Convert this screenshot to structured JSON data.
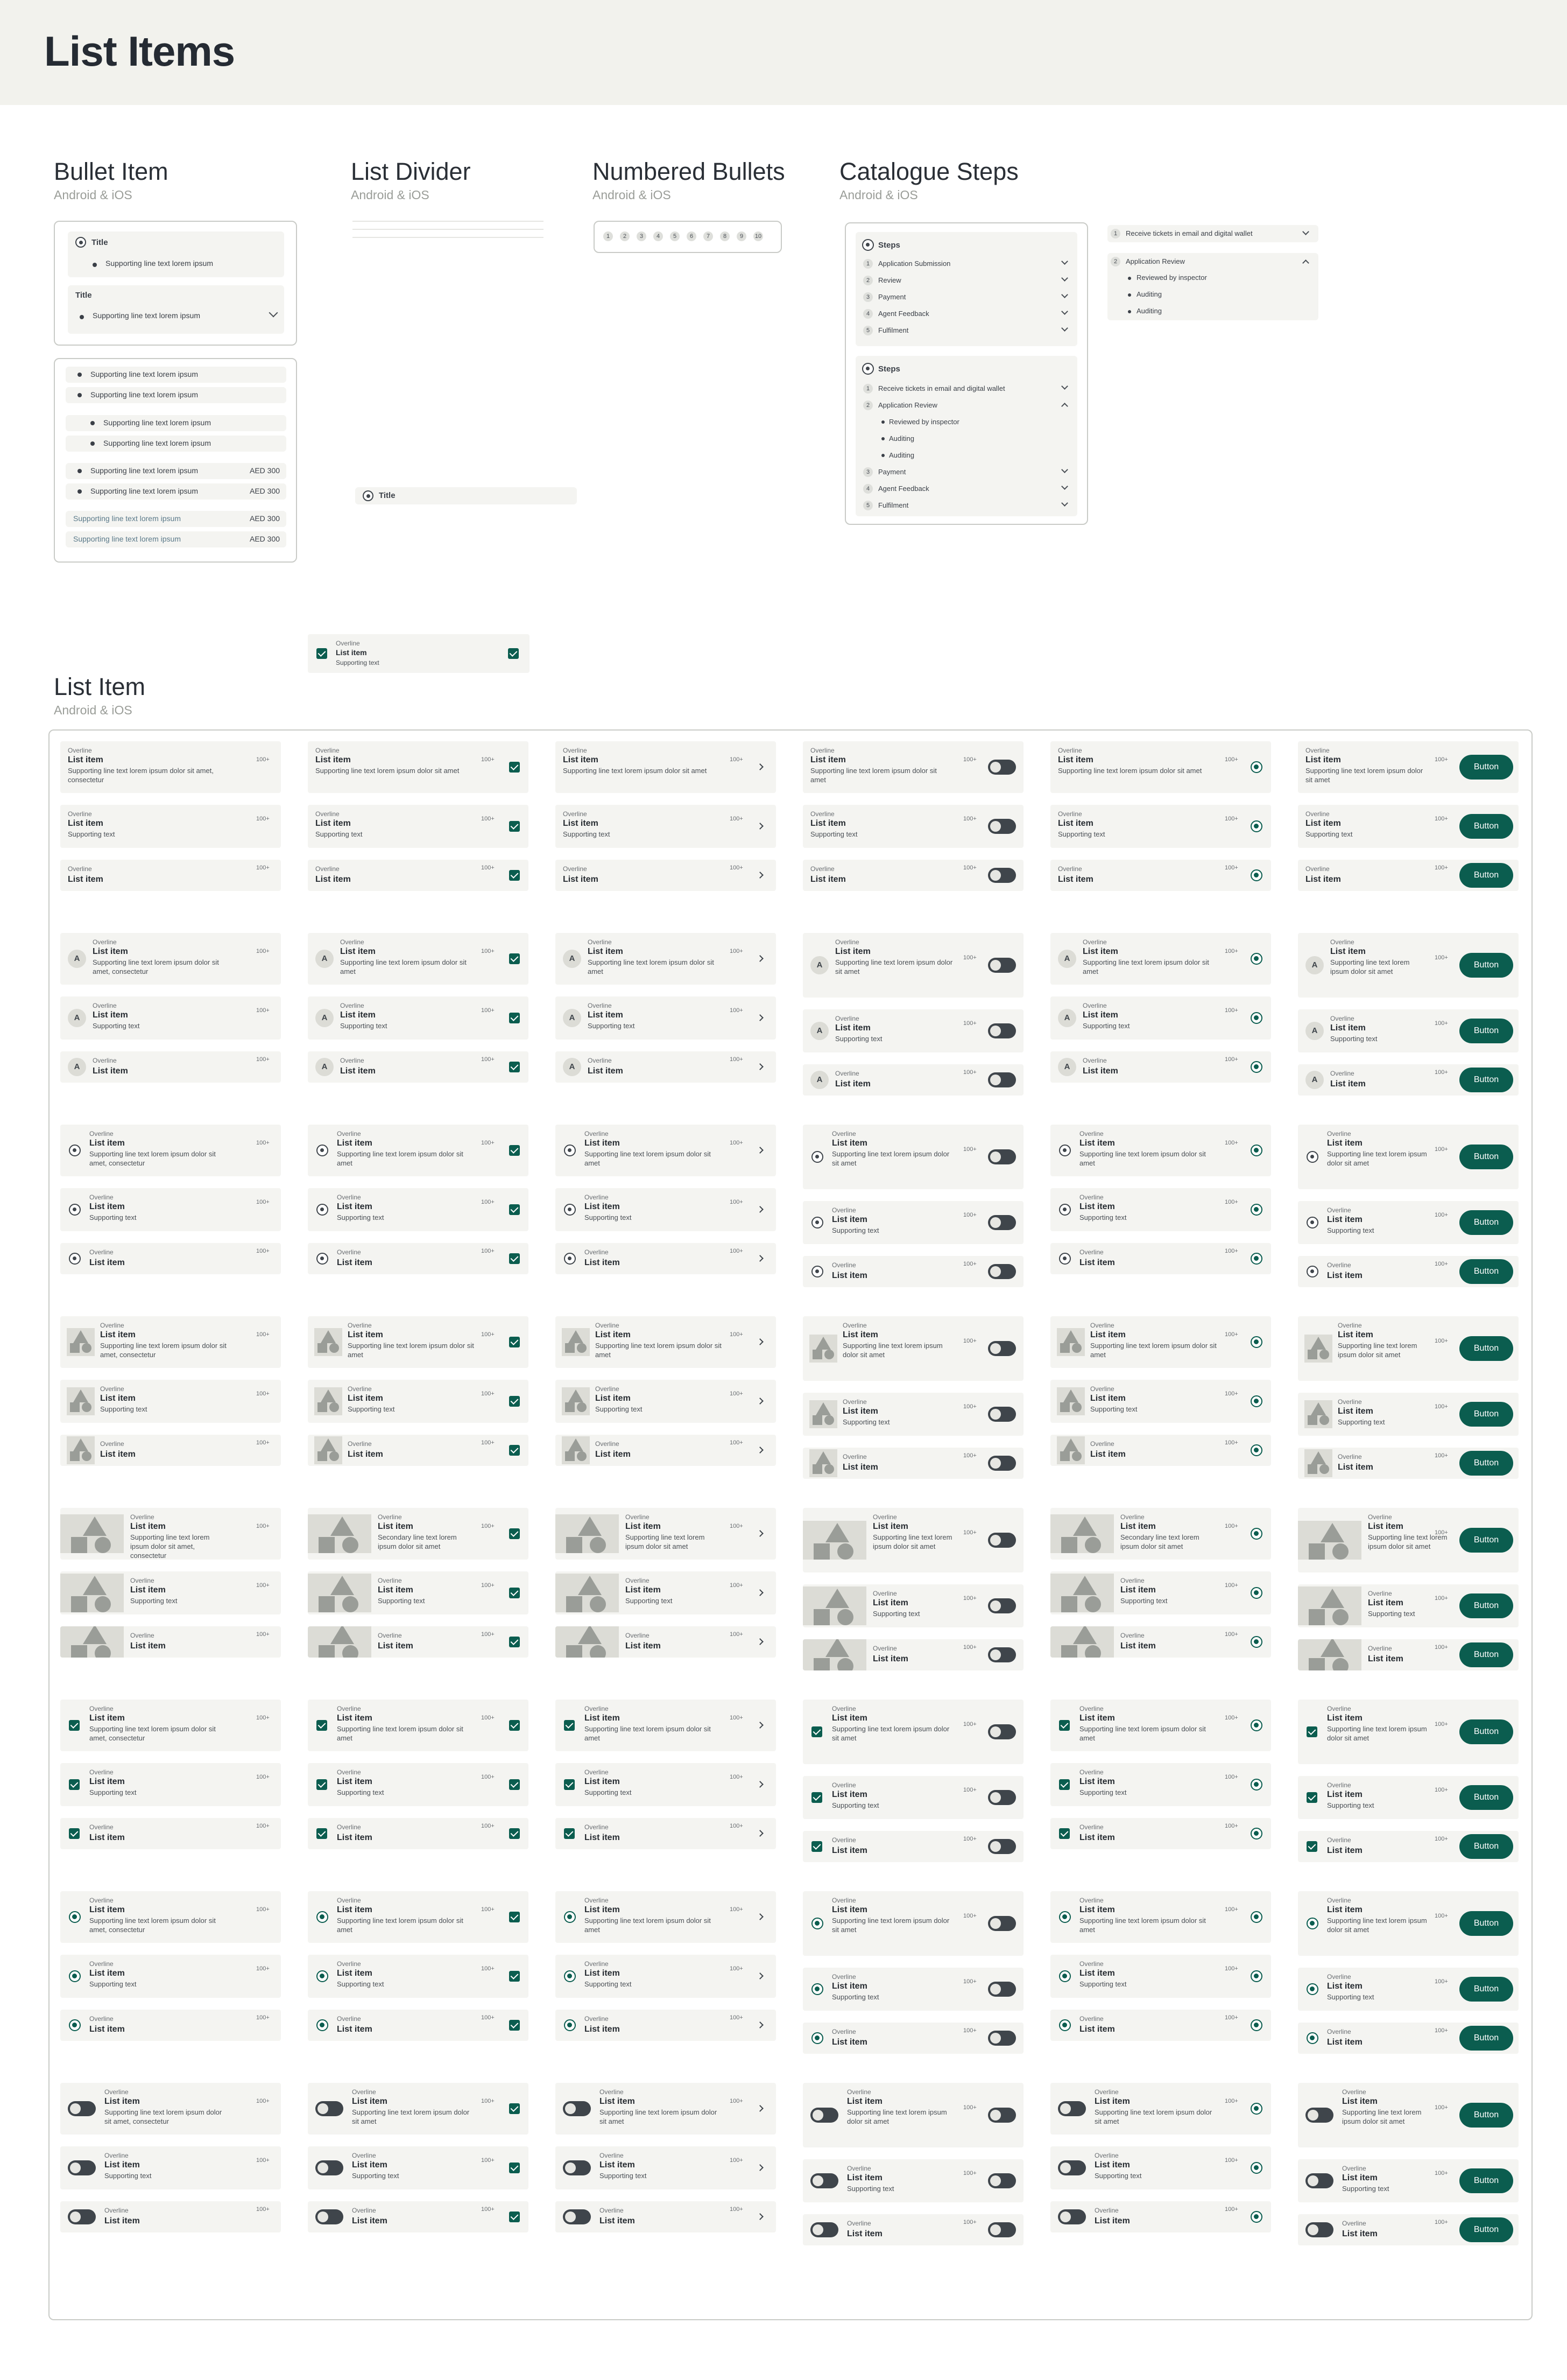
{
  "page_title": "List Items",
  "sections": {
    "bullet": {
      "title": "Bullet Item",
      "sub": "Android & iOS"
    },
    "divider": {
      "title": "List Divider",
      "sub": "Android & iOS"
    },
    "numbered": {
      "title": "Numbered Bullets",
      "sub": "Android & iOS"
    },
    "catalogue": {
      "title": "Catalogue Steps",
      "sub": "Android & iOS"
    },
    "listitem": {
      "title": "List Item",
      "sub": "Android & iOS"
    }
  },
  "bullet": {
    "title": "Title",
    "supporting": "Supporting line text lorem ipsum",
    "price": "AED 300"
  },
  "divider": {
    "title": "Title"
  },
  "numbered": [
    "1",
    "2",
    "3",
    "4",
    "5",
    "6",
    "7",
    "8",
    "9",
    "10"
  ],
  "catalogue": {
    "steps_label": "Steps",
    "group1": [
      "Application Submission",
      "Review",
      "Payment",
      "Agent Feedback",
      "Fulfilment"
    ],
    "group2_first": "Receive tickets in email and digital wallet",
    "group2_review": "Application Review",
    "group2_sub": [
      "Reviewed by inspector",
      "Auditing",
      "Auditing"
    ],
    "group2_rest": [
      "Payment",
      "Agent Feedback",
      "Fulfilment"
    ],
    "side_first": "Receive tickets in email and digital wallet",
    "side_review": "Application Review",
    "side_sub": [
      "Reviewed by inspector",
      "Auditing",
      "Auditing"
    ]
  },
  "list": {
    "overline": "Overline",
    "title": "List item",
    "meta": "100+",
    "button": "Button",
    "avatar": "A",
    "support_long_1": "Supporting line text lorem ipsum dolor sit amet, consectetur",
    "support_long_2": "Supporting line text lorem ipsum dolor sit amet",
    "support_long_3": "Supporting line text lorem ipsum dolor sit amet, consectetur",
    "support_med": "Supporting line text lorem ipsum",
    "support_short": "Supporting text",
    "secondary": "Secondary line text lorem ipsum dolor sit amet"
  },
  "colors": {
    "accent": "#0b5d4f",
    "banner": "#f2f2ed",
    "row": "#f4f4f1"
  }
}
